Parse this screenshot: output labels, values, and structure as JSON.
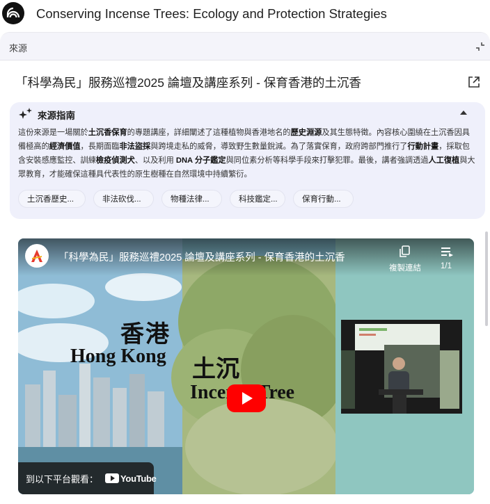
{
  "app": {
    "title": "Conserving Incense Trees: Ecology and Protection Strategies"
  },
  "sources_panel": {
    "label": "來源",
    "document_title": "「科學為民」服務巡禮2025 論壇及講座系列 - 保育香港的土沉香"
  },
  "source_guide": {
    "title": "來源指南",
    "summary": [
      {
        "text": "這份來源是一場關於",
        "bold": false
      },
      {
        "text": "土沉香保育",
        "bold": true
      },
      {
        "text": "的專題講座，詳細闡述了這種植物與香港地名的",
        "bold": false
      },
      {
        "text": "歷史淵源",
        "bold": true
      },
      {
        "text": "及其生態特徵。內容核心圍繞在土沉香因具備極高的",
        "bold": false
      },
      {
        "text": "經濟價值",
        "bold": true
      },
      {
        "text": "，長期面臨",
        "bold": false
      },
      {
        "text": "非法盜採",
        "bold": true
      },
      {
        "text": "與跨境走私的威脅，導致野生數量銳減。為了落實保育，政府跨部門推行了",
        "bold": false
      },
      {
        "text": "行動計畫",
        "bold": true
      },
      {
        "text": "，採取包含安裝感應監控、訓練",
        "bold": false
      },
      {
        "text": "檢疫偵測犬",
        "bold": true
      },
      {
        "text": "、以及利用 ",
        "bold": false
      },
      {
        "text": "DNA 分子鑑定",
        "bold": true
      },
      {
        "text": "與同位素分析等科學手段來打擊犯罪。最後，講者強調透過",
        "bold": false
      },
      {
        "text": "人工復植",
        "bold": true
      },
      {
        "text": "與大眾教育，才能確保這種具代表性的原生樹種在自然環境中持續繁衍。",
        "bold": false
      }
    ],
    "chips": [
      "土沉香歷史...",
      "非法砍伐...",
      "物種法律...",
      "科技鑑定...",
      "保育行動..."
    ]
  },
  "video": {
    "title": "「科學為民」服務巡禮2025 論壇及講座系列 - 保育香港的土沉香",
    "copy_link_label": "複製連結",
    "playlist_count": "1/1",
    "frame_text_hk_zh": "香港",
    "frame_text_hk_en": "Hong Kong",
    "frame_text_tree_zh": "土沉",
    "frame_text_tree_en": "Incense Tree",
    "watch_on_label": "到以下平台觀看：",
    "youtube_label": "YouTube"
  },
  "colors": {
    "guide_bg": "#eff0fb",
    "play_button": "#ff0000"
  }
}
